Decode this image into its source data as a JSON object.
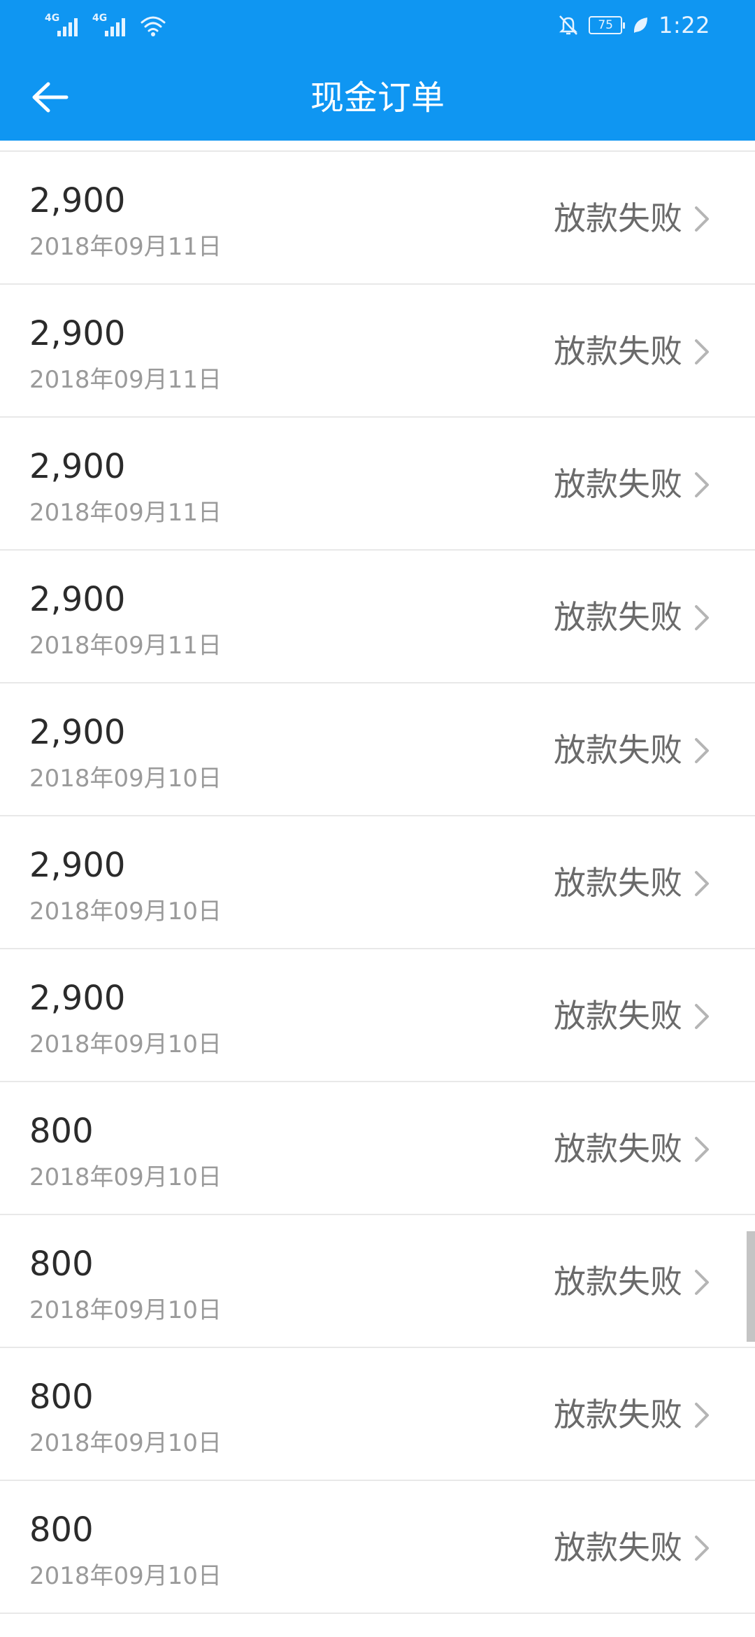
{
  "status_bar": {
    "network_1": "4G",
    "network_2": "4G",
    "battery": "75",
    "time": "1:22"
  },
  "header": {
    "title": "现金订单"
  },
  "orders": [
    {
      "amount": "2,900",
      "date": "2018年09月11日",
      "status": "放款失败"
    },
    {
      "amount": "2,900",
      "date": "2018年09月11日",
      "status": "放款失败"
    },
    {
      "amount": "2,900",
      "date": "2018年09月11日",
      "status": "放款失败"
    },
    {
      "amount": "2,900",
      "date": "2018年09月11日",
      "status": "放款失败"
    },
    {
      "amount": "2,900",
      "date": "2018年09月10日",
      "status": "放款失败"
    },
    {
      "amount": "2,900",
      "date": "2018年09月10日",
      "status": "放款失败"
    },
    {
      "amount": "2,900",
      "date": "2018年09月10日",
      "status": "放款失败"
    },
    {
      "amount": "800",
      "date": "2018年09月10日",
      "status": "放款失败"
    },
    {
      "amount": "800",
      "date": "2018年09月10日",
      "status": "放款失败"
    },
    {
      "amount": "800",
      "date": "2018年09月10日",
      "status": "放款失败"
    },
    {
      "amount": "800",
      "date": "2018年09月10日",
      "status": "放款失败"
    }
  ],
  "colors": {
    "header_bg": "#0f96f2",
    "amount_text": "#2b2b2b",
    "date_text": "#9a9a9a",
    "status_text": "#6a6a6a",
    "divider": "#e8e8e8"
  }
}
